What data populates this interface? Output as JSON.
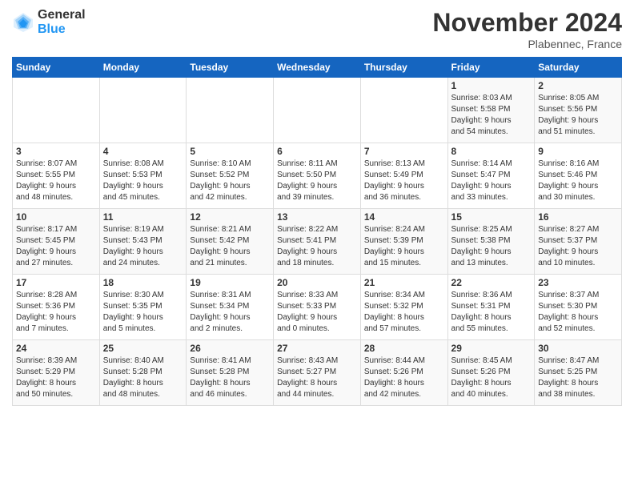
{
  "logo": {
    "general": "General",
    "blue": "Blue"
  },
  "header": {
    "title": "November 2024",
    "location": "Plabennec, France"
  },
  "weekdays": [
    "Sunday",
    "Monday",
    "Tuesday",
    "Wednesday",
    "Thursday",
    "Friday",
    "Saturday"
  ],
  "weeks": [
    [
      {
        "day": "",
        "text": ""
      },
      {
        "day": "",
        "text": ""
      },
      {
        "day": "",
        "text": ""
      },
      {
        "day": "",
        "text": ""
      },
      {
        "day": "",
        "text": ""
      },
      {
        "day": "1",
        "text": "Sunrise: 8:03 AM\nSunset: 5:58 PM\nDaylight: 9 hours\nand 54 minutes."
      },
      {
        "day": "2",
        "text": "Sunrise: 8:05 AM\nSunset: 5:56 PM\nDaylight: 9 hours\nand 51 minutes."
      }
    ],
    [
      {
        "day": "3",
        "text": "Sunrise: 8:07 AM\nSunset: 5:55 PM\nDaylight: 9 hours\nand 48 minutes."
      },
      {
        "day": "4",
        "text": "Sunrise: 8:08 AM\nSunset: 5:53 PM\nDaylight: 9 hours\nand 45 minutes."
      },
      {
        "day": "5",
        "text": "Sunrise: 8:10 AM\nSunset: 5:52 PM\nDaylight: 9 hours\nand 42 minutes."
      },
      {
        "day": "6",
        "text": "Sunrise: 8:11 AM\nSunset: 5:50 PM\nDaylight: 9 hours\nand 39 minutes."
      },
      {
        "day": "7",
        "text": "Sunrise: 8:13 AM\nSunset: 5:49 PM\nDaylight: 9 hours\nand 36 minutes."
      },
      {
        "day": "8",
        "text": "Sunrise: 8:14 AM\nSunset: 5:47 PM\nDaylight: 9 hours\nand 33 minutes."
      },
      {
        "day": "9",
        "text": "Sunrise: 8:16 AM\nSunset: 5:46 PM\nDaylight: 9 hours\nand 30 minutes."
      }
    ],
    [
      {
        "day": "10",
        "text": "Sunrise: 8:17 AM\nSunset: 5:45 PM\nDaylight: 9 hours\nand 27 minutes."
      },
      {
        "day": "11",
        "text": "Sunrise: 8:19 AM\nSunset: 5:43 PM\nDaylight: 9 hours\nand 24 minutes."
      },
      {
        "day": "12",
        "text": "Sunrise: 8:21 AM\nSunset: 5:42 PM\nDaylight: 9 hours\nand 21 minutes."
      },
      {
        "day": "13",
        "text": "Sunrise: 8:22 AM\nSunset: 5:41 PM\nDaylight: 9 hours\nand 18 minutes."
      },
      {
        "day": "14",
        "text": "Sunrise: 8:24 AM\nSunset: 5:39 PM\nDaylight: 9 hours\nand 15 minutes."
      },
      {
        "day": "15",
        "text": "Sunrise: 8:25 AM\nSunset: 5:38 PM\nDaylight: 9 hours\nand 13 minutes."
      },
      {
        "day": "16",
        "text": "Sunrise: 8:27 AM\nSunset: 5:37 PM\nDaylight: 9 hours\nand 10 minutes."
      }
    ],
    [
      {
        "day": "17",
        "text": "Sunrise: 8:28 AM\nSunset: 5:36 PM\nDaylight: 9 hours\nand 7 minutes."
      },
      {
        "day": "18",
        "text": "Sunrise: 8:30 AM\nSunset: 5:35 PM\nDaylight: 9 hours\nand 5 minutes."
      },
      {
        "day": "19",
        "text": "Sunrise: 8:31 AM\nSunset: 5:34 PM\nDaylight: 9 hours\nand 2 minutes."
      },
      {
        "day": "20",
        "text": "Sunrise: 8:33 AM\nSunset: 5:33 PM\nDaylight: 9 hours\nand 0 minutes."
      },
      {
        "day": "21",
        "text": "Sunrise: 8:34 AM\nSunset: 5:32 PM\nDaylight: 8 hours\nand 57 minutes."
      },
      {
        "day": "22",
        "text": "Sunrise: 8:36 AM\nSunset: 5:31 PM\nDaylight: 8 hours\nand 55 minutes."
      },
      {
        "day": "23",
        "text": "Sunrise: 8:37 AM\nSunset: 5:30 PM\nDaylight: 8 hours\nand 52 minutes."
      }
    ],
    [
      {
        "day": "24",
        "text": "Sunrise: 8:39 AM\nSunset: 5:29 PM\nDaylight: 8 hours\nand 50 minutes."
      },
      {
        "day": "25",
        "text": "Sunrise: 8:40 AM\nSunset: 5:28 PM\nDaylight: 8 hours\nand 48 minutes."
      },
      {
        "day": "26",
        "text": "Sunrise: 8:41 AM\nSunset: 5:28 PM\nDaylight: 8 hours\nand 46 minutes."
      },
      {
        "day": "27",
        "text": "Sunrise: 8:43 AM\nSunset: 5:27 PM\nDaylight: 8 hours\nand 44 minutes."
      },
      {
        "day": "28",
        "text": "Sunrise: 8:44 AM\nSunset: 5:26 PM\nDaylight: 8 hours\nand 42 minutes."
      },
      {
        "day": "29",
        "text": "Sunrise: 8:45 AM\nSunset: 5:26 PM\nDaylight: 8 hours\nand 40 minutes."
      },
      {
        "day": "30",
        "text": "Sunrise: 8:47 AM\nSunset: 5:25 PM\nDaylight: 8 hours\nand 38 minutes."
      }
    ]
  ]
}
